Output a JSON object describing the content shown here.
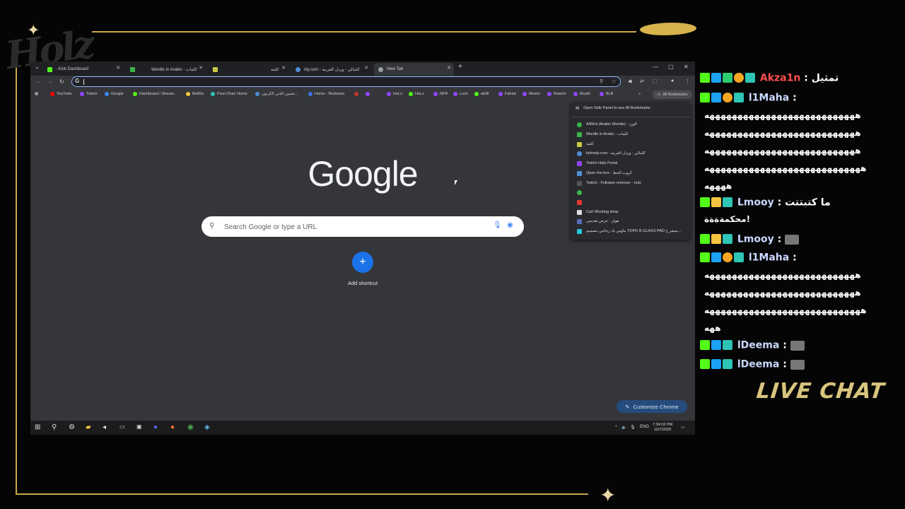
{
  "overlay": {
    "logo_text": "Holz",
    "live_chat": "LIVE CHAT"
  },
  "browser": {
    "tabs": [
      {
        "title": "- Kick Dashboard",
        "color": "#53fc18"
      },
      {
        "title": "Wordle in Arabic - كلمات",
        "color": "#3bb54a"
      },
      {
        "title": "كلمة",
        "color": "#c9c941"
      },
      {
        "title": "nly.com - كلمالي - وردل العربية",
        "color": "#4f8fd6"
      },
      {
        "title": "New Tab",
        "color": "#9aa0a6"
      }
    ],
    "new_tab_symbol": "+",
    "omnibox": {
      "value": "",
      "g_label": "G"
    },
    "bookmarks": [
      {
        "label": "YouTube",
        "color": "#ff0000"
      },
      {
        "label": "Twitch",
        "color": "#9146ff"
      },
      {
        "label": "Google",
        "color": "#4285f4"
      },
      {
        "label": "Dashboard / Stream...",
        "color": "#53fc18"
      },
      {
        "label": "BotRix",
        "color": "#f5c542"
      },
      {
        "label": "Pixel Chat: Home",
        "color": "#2ec4b6"
      },
      {
        "label": "تخمين اغاني الكرتون...",
        "color": "#4f8fd6"
      },
      {
        "label": "Home - Redream",
        "color": "#3f6fe8"
      },
      {
        "label": "",
        "color": "#c0392b"
      },
      {
        "label": "",
        "color": "#9146ff"
      },
      {
        "label": "HoLz",
        "color": "#9146ff"
      },
      {
        "label": "HoLz",
        "color": "#53fc18"
      },
      {
        "label": "NFR",
        "color": "#9146ff"
      },
      {
        "label": "Lozh",
        "color": "#9146ff"
      },
      {
        "label": "ak9ll",
        "color": "#53fc18"
      },
      {
        "label": "Fahad",
        "color": "#9146ff"
      },
      {
        "label": "Meshz",
        "color": "#9146ff"
      },
      {
        "label": "Rwerm",
        "color": "#9146ff"
      },
      {
        "label": "Musth",
        "color": "#9146ff"
      },
      {
        "label": "BLB",
        "color": "#9146ff"
      }
    ],
    "all_bookmarks": "All Bookmarks",
    "bookmark_menu": {
      "header": "Open Side Panel to see All Bookmarks",
      "items": [
        {
          "label": "AlWird (Arabic Wordle) - الورد",
          "color": "#3bb54a"
        },
        {
          "label": "Wordle in Arabic - كلمات",
          "color": "#3bb54a"
        },
        {
          "label": "كلمة",
          "color": "#c9c941"
        },
        {
          "label": "kelmaly.com - كلمالي - وردل العربية",
          "color": "#4f8fd6"
        },
        {
          "label": "Twitch Help Portal",
          "color": "#9146ff"
        },
        {
          "label": "Open the box - كروت الحظ",
          "color": "#4f8fd6"
        },
        {
          "label": "Twitch - Follower remover - holz",
          "color": "#555"
        },
        {
          "label": "",
          "color": "#3bb54a"
        },
        {
          "label": "",
          "color": "#e53935"
        },
        {
          "label": "Cart Wooting shop",
          "color": "#dddddd"
        },
        {
          "label": "هولز - عرض تقديمي",
          "color": "#5c6bc0"
        },
        {
          "label": "ماوس باد زجاجي بتصميم TOPO B GLASS PAD بسعر ج...",
          "color": "#26c6da"
        }
      ]
    },
    "google": {
      "logo": "Google",
      "search_placeholder": "Search Google or type a URL",
      "add_shortcut": "Add shortcut",
      "customize": "Customize Chrome"
    },
    "taskbar": {
      "language": "ENG",
      "time": "7:34:02 PM",
      "date": "10/7/2025"
    }
  },
  "chat": {
    "messages": [
      {
        "user": "Akza1n",
        "text": "تمثيل",
        "user_color": "#ff4f4f"
      },
      {
        "user": "l1Maha",
        "text": "",
        "user_color": "#c9d8ff"
      },
      {
        "user": "Lmooy",
        "text": "ما كتبتتت",
        "user_color": "#c9d8ff"
      },
      {
        "user": "Lmooy",
        "text": "",
        "user_color": "#c9d8ff"
      },
      {
        "user": "l1Maha",
        "text": "",
        "user_color": "#c9d8ff"
      },
      {
        "user": "lDeema",
        "text": "",
        "user_color": "#c9d8ff"
      },
      {
        "user": "lDeema",
        "text": "",
        "user_color": "#c9d8ff"
      }
    ],
    "wrap_lines": [
      "هههههههههههههههههههههههههههه",
      "هههههههههههههههههههههههههههه",
      "هههههههههههههههههههههههههههه",
      "ههههههههههههههههههههههههههههه",
      "ههههه",
      "محكمةةةة!",
      "هههههههههههههههههههههههههههه",
      "هههههههههههههههههههههههههههه",
      "ههههههههههههههههههههههههههههه",
      "ههه"
    ]
  }
}
